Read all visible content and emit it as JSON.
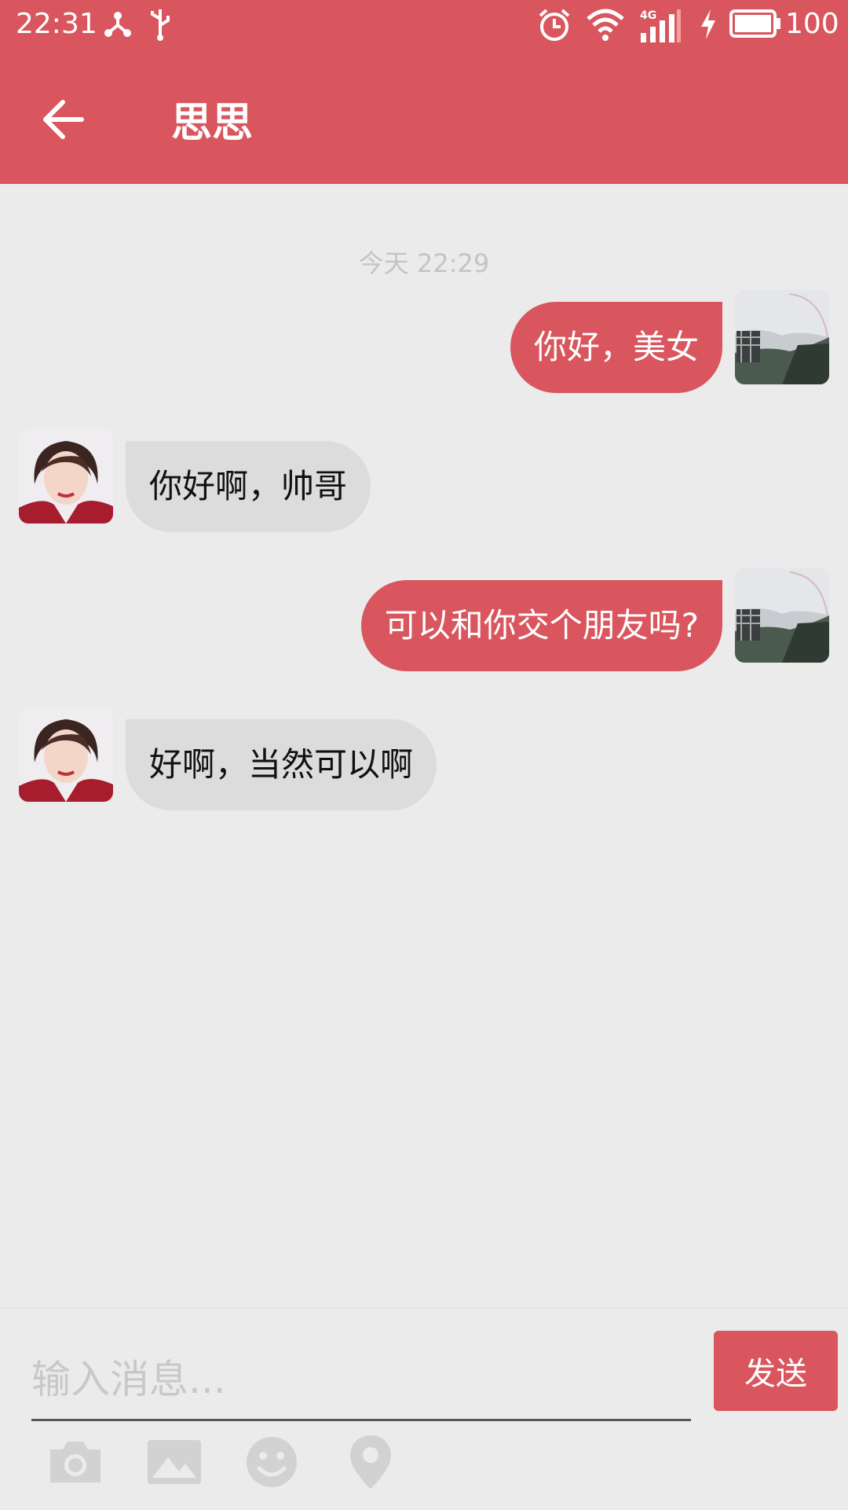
{
  "status_bar": {
    "time": "22:31",
    "network": "4G",
    "battery": "100"
  },
  "header": {
    "title": "思思"
  },
  "chat": {
    "timestamp": "今天 22:29",
    "messages": [
      {
        "direction": "out",
        "text": "你好，美女"
      },
      {
        "direction": "in",
        "text": "你好啊，帅哥"
      },
      {
        "direction": "out",
        "text": "可以和你交个朋友吗?"
      },
      {
        "direction": "in",
        "text": "好啊，当然可以啊"
      }
    ]
  },
  "composer": {
    "placeholder": "输入消息...",
    "value": "",
    "send_label": "发送"
  },
  "toolbar": [
    "camera-icon",
    "image-icon",
    "emoji-icon",
    "location-icon"
  ],
  "colors": {
    "accent": "#d9565e",
    "incoming_bubble": "#dcdcdc",
    "background": "#ebebeb"
  }
}
